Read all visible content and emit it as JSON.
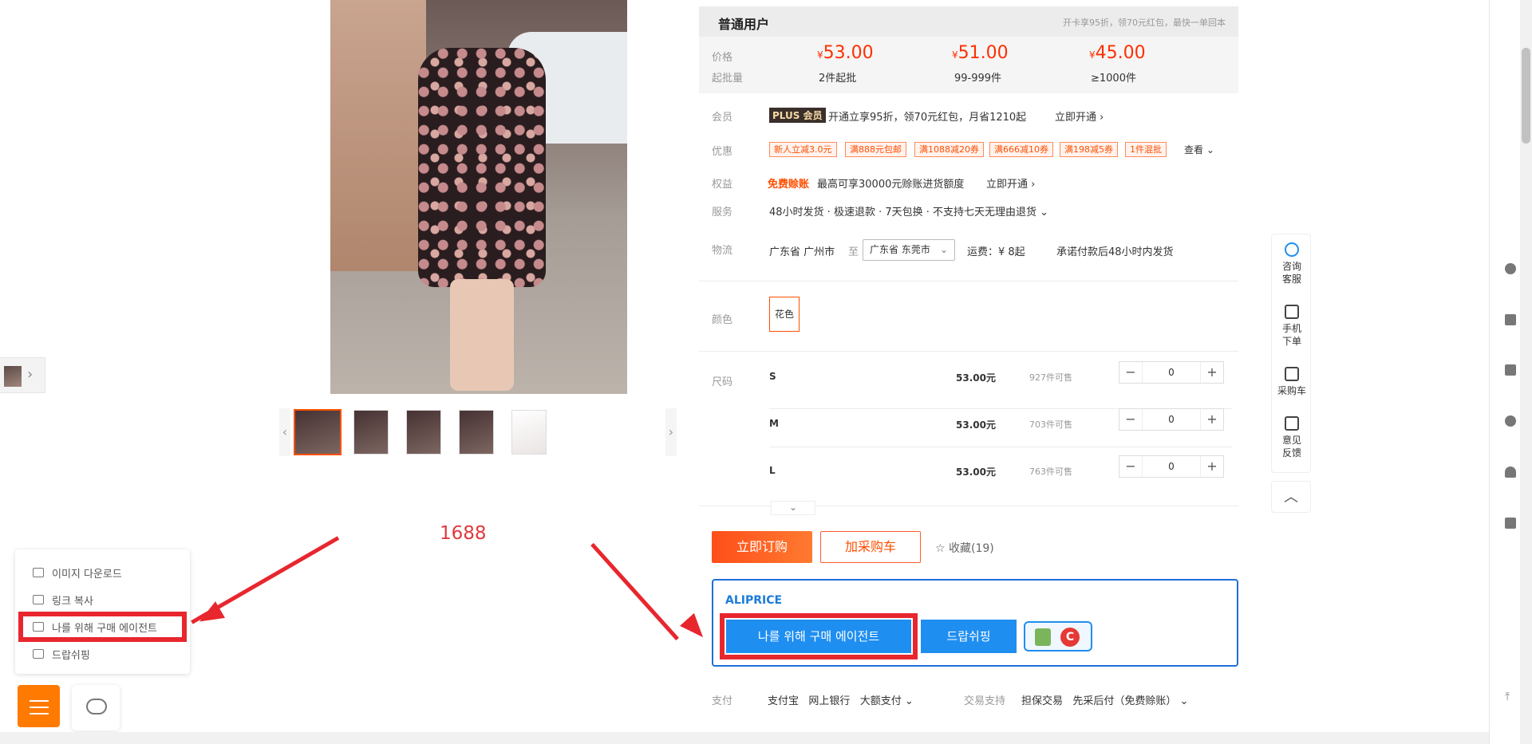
{
  "price": {
    "user_type": "普通用户",
    "promo_note": "开卡享95折，领70元红包，最快一单回本",
    "label_price": "价格",
    "label_moq": "起批量",
    "tiers": [
      {
        "currency": "¥",
        "amount": "53.00",
        "qty": "2件起批"
      },
      {
        "currency": "¥",
        "amount": "51.00",
        "qty": "99-999件"
      },
      {
        "currency": "¥",
        "amount": "45.00",
        "qty": "≥1000件"
      }
    ]
  },
  "member": {
    "label": "会员",
    "badge": "PLUS 会员",
    "text": "开通立享95折，领70元红包，月省1210起",
    "action": "立即开通 ›"
  },
  "discount": {
    "label": "优惠",
    "coupons": [
      "新人立减3.0元",
      "满888元包邮",
      "满1088减20券",
      "满666减10券",
      "满198减5券",
      "1件混批"
    ],
    "view": "查看 ⌄"
  },
  "benefit": {
    "label": "权益",
    "tag": "免费赊账",
    "text": "最高可享30000元赊账进货额度",
    "action": "立即开通 ›"
  },
  "service": {
    "label": "服务",
    "text": "48小时发货 · 极速退款 · 7天包换 · 不支持七天无理由退货 ⌄"
  },
  "logistics": {
    "label": "物流",
    "from": "广东省 广州市",
    "to_label": "至",
    "to": "广东省 东莞市",
    "fee": "运费：¥ 8起",
    "promise": "承诺付款后48小时内发货"
  },
  "color": {
    "label": "颜色",
    "option": "花色"
  },
  "size": {
    "label": "尺码",
    "rows": [
      {
        "size": "S",
        "price": "53.00元",
        "stock": "927件可售",
        "qty": "0"
      },
      {
        "size": "M",
        "price": "53.00元",
        "stock": "703件可售",
        "qty": "0"
      },
      {
        "size": "L",
        "price": "53.00元",
        "stock": "763件可售",
        "qty": "0"
      }
    ],
    "expand": "⌄"
  },
  "actions": {
    "buy": "立即订购",
    "cart": "加采购车",
    "fav": "☆ 收藏(19)"
  },
  "aliprice": {
    "title": "ALIPRICE",
    "agent": "나를 위해 구매 에이전트",
    "dropship": "드랍쉬핑",
    "c_letter": "C"
  },
  "payment": {
    "label": "支付",
    "methods": "支付宝   网上银行   大额支付 ⌄",
    "trade_label": "交易支持",
    "trade": "担保交易   先采后付（免费赊账） ⌄"
  },
  "annotation": "1688",
  "context_menu": [
    "이미지 다운로드",
    "링크 복사",
    "나를 위해 구매 에이전트",
    "드랍쉬핑"
  ],
  "float_tools": [
    {
      "label": "咨询\n客服",
      "icon": "chat-bubble-icon"
    },
    {
      "label": "手机\n下单",
      "icon": "qr-code-icon"
    },
    {
      "label": "采购车",
      "icon": "cart-icon"
    },
    {
      "label": "意见\n反馈",
      "icon": "edit-icon"
    }
  ],
  "float_top": "︿",
  "colors": {
    "accent": "#ff5000",
    "price": "#ff2f00",
    "aliprice_blue": "#1f8ef1",
    "highlight_red": "#e8262e",
    "fab_orange": "#ff7a00"
  }
}
